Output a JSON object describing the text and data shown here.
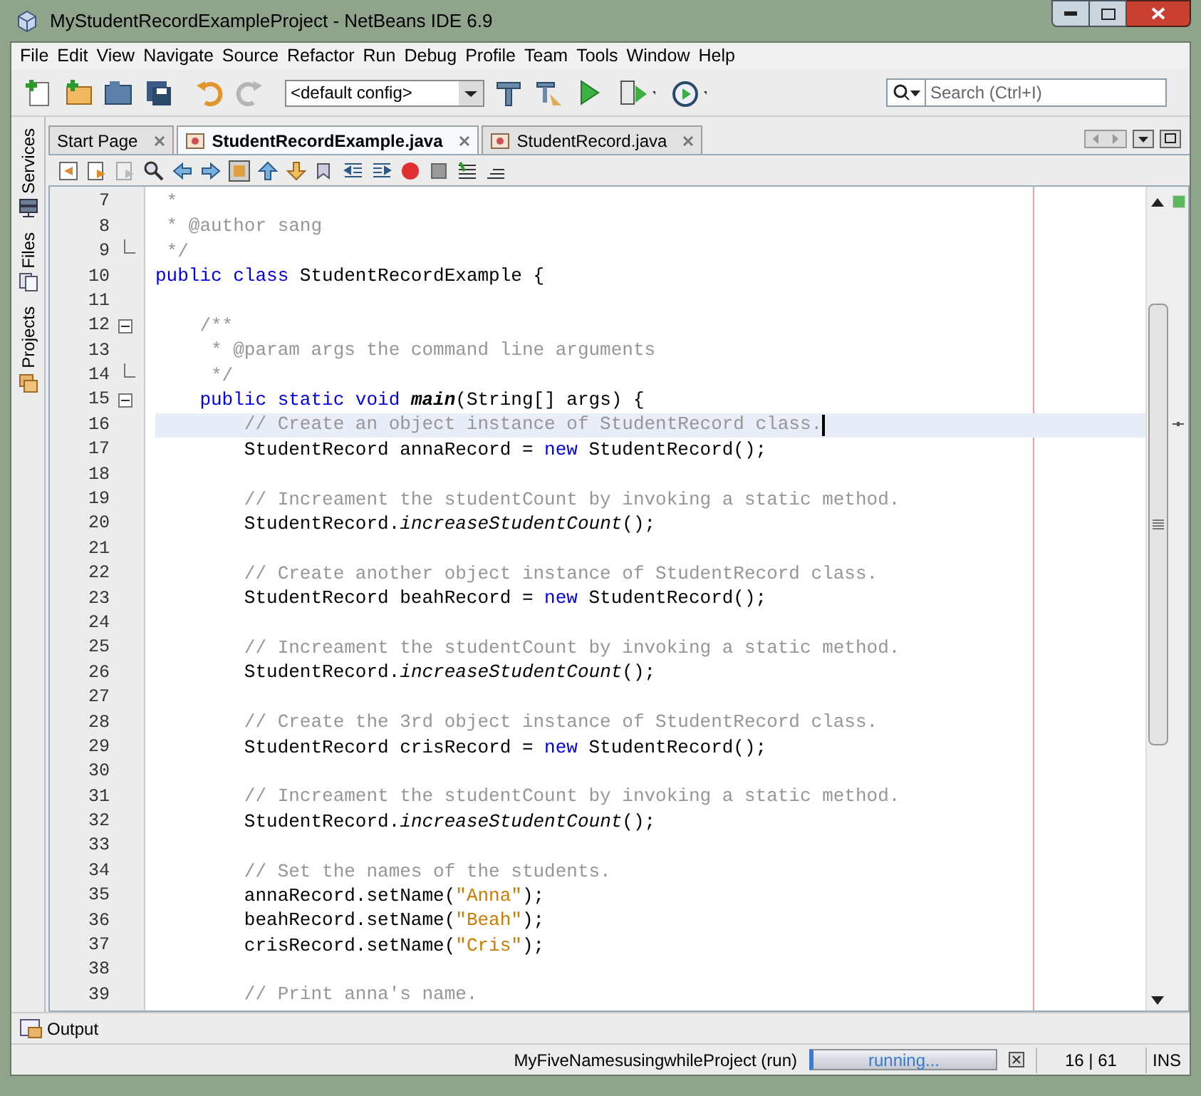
{
  "window": {
    "title": "MyStudentRecordExampleProject - NetBeans IDE 6.9"
  },
  "menu": [
    "File",
    "Edit",
    "View",
    "Navigate",
    "Source",
    "Refactor",
    "Run",
    "Debug",
    "Profile",
    "Team",
    "Tools",
    "Window",
    "Help"
  ],
  "toolbar": {
    "config": "<default config>",
    "search": {
      "placeholder": "Search (Ctrl+I)"
    }
  },
  "side_tabs": [
    {
      "label": "Services",
      "kind": "services"
    },
    {
      "label": "Files",
      "kind": "files"
    },
    {
      "label": "Projects",
      "kind": "projects"
    }
  ],
  "tabs": [
    {
      "label": "Start Page",
      "selected": false,
      "kind": "page"
    },
    {
      "label": "StudentRecordExample.java",
      "selected": true,
      "kind": "java"
    },
    {
      "label": "StudentRecord.java",
      "selected": false,
      "kind": "java"
    }
  ],
  "editor": {
    "lines": [
      {
        "number": "7",
        "kind": "code",
        "current": false,
        "tokens": [
          {
            "kind": "comment",
            "text": " *"
          }
        ]
      },
      {
        "number": "8",
        "kind": "code",
        "current": false,
        "tokens": [
          {
            "kind": "comment",
            "text": " * @author sang"
          }
        ]
      },
      {
        "number": "9",
        "kind": "fold_end",
        "current": false,
        "tokens": [
          {
            "kind": "comment",
            "text": " */"
          }
        ]
      },
      {
        "number": "10",
        "kind": "code",
        "current": false,
        "tokens": [
          {
            "kind": "keyword",
            "text": "public class "
          },
          {
            "kind": "plain",
            "text": "StudentRecordExample {"
          }
        ]
      },
      {
        "number": "11",
        "kind": "code",
        "current": false
      },
      {
        "number": "12",
        "kind": "fold_start",
        "current": false,
        "tokens": [
          {
            "kind": "comment",
            "text": "    /**"
          }
        ]
      },
      {
        "number": "13",
        "kind": "code",
        "current": false,
        "tokens": [
          {
            "kind": "comment",
            "text": "     * @param args the command line arguments"
          }
        ]
      },
      {
        "number": "14",
        "kind": "fold_end",
        "current": false,
        "tokens": [
          {
            "kind": "comment",
            "text": "     */"
          }
        ]
      },
      {
        "number": "15",
        "kind": "fold_start",
        "current": false,
        "tokens": [
          {
            "kind": "keyword",
            "text": "    public static void "
          },
          {
            "kind": "declaration",
            "text": "main"
          },
          {
            "kind": "plain",
            "text": "(String[] args) {"
          }
        ]
      },
      {
        "number": "16",
        "kind": "code",
        "current": true,
        "tokens": [
          {
            "kind": "comment",
            "text": "        // Create an object instance of StudentRecord class."
          }
        ]
      },
      {
        "number": "17",
        "kind": "code",
        "current": false,
        "tokens": [
          {
            "kind": "plain",
            "text": "        StudentRecord annaRecord = "
          },
          {
            "kind": "keyword",
            "text": "new"
          },
          {
            "kind": "plain",
            "text": " StudentRecord();"
          }
        ]
      },
      {
        "number": "18",
        "kind": "code",
        "current": false
      },
      {
        "number": "19",
        "kind": "code",
        "current": false,
        "tokens": [
          {
            "kind": "comment",
            "text": "        // Increament the studentCount by invoking a static method."
          }
        ]
      },
      {
        "number": "20",
        "kind": "code",
        "current": false,
        "tokens": [
          {
            "kind": "plain",
            "text": "        StudentRecord."
          },
          {
            "kind": "static",
            "text": "increaseStudentCount"
          },
          {
            "kind": "plain",
            "text": "();"
          }
        ]
      },
      {
        "number": "21",
        "kind": "code",
        "current": false
      },
      {
        "number": "22",
        "kind": "code",
        "current": false,
        "tokens": [
          {
            "kind": "comment",
            "text": "        // Create another object instance of StudentRecord class."
          }
        ]
      },
      {
        "number": "23",
        "kind": "code",
        "current": false,
        "tokens": [
          {
            "kind": "plain",
            "text": "        StudentRecord beahRecord = "
          },
          {
            "kind": "keyword",
            "text": "new"
          },
          {
            "kind": "plain",
            "text": " StudentRecord();"
          }
        ]
      },
      {
        "number": "24",
        "kind": "code",
        "current": false
      },
      {
        "number": "25",
        "kind": "code",
        "current": false,
        "tokens": [
          {
            "kind": "comment",
            "text": "        // Increament the studentCount by invoking a static method."
          }
        ]
      },
      {
        "number": "26",
        "kind": "code",
        "current": false,
        "tokens": [
          {
            "kind": "plain",
            "text": "        StudentRecord."
          },
          {
            "kind": "static",
            "text": "increaseStudentCount"
          },
          {
            "kind": "plain",
            "text": "();"
          }
        ]
      },
      {
        "number": "27",
        "kind": "code",
        "current": false
      },
      {
        "number": "28",
        "kind": "code",
        "current": false,
        "tokens": [
          {
            "kind": "comment",
            "text": "        // Create the 3rd object instance of StudentRecord class."
          }
        ]
      },
      {
        "number": "29",
        "kind": "code",
        "current": false,
        "tokens": [
          {
            "kind": "plain",
            "text": "        StudentRecord crisRecord = "
          },
          {
            "kind": "keyword",
            "text": "new"
          },
          {
            "kind": "plain",
            "text": " StudentRecord();"
          }
        ]
      },
      {
        "number": "30",
        "kind": "code",
        "current": false
      },
      {
        "number": "31",
        "kind": "code",
        "current": false,
        "tokens": [
          {
            "kind": "comment",
            "text": "        // Increament the studentCount by invoking a static method."
          }
        ]
      },
      {
        "number": "32",
        "kind": "code",
        "current": false,
        "tokens": [
          {
            "kind": "plain",
            "text": "        StudentRecord."
          },
          {
            "kind": "static",
            "text": "increaseStudentCount"
          },
          {
            "kind": "plain",
            "text": "();"
          }
        ]
      },
      {
        "number": "33",
        "kind": "code",
        "current": false
      },
      {
        "number": "34",
        "kind": "code",
        "current": false,
        "tokens": [
          {
            "kind": "comment",
            "text": "        // Set the names of the students."
          }
        ]
      },
      {
        "number": "35",
        "kind": "code",
        "current": false,
        "tokens": [
          {
            "kind": "plain",
            "text": "        annaRecord.setName("
          },
          {
            "kind": "string",
            "text": "\"Anna\""
          },
          {
            "kind": "plain",
            "text": ");"
          }
        ]
      },
      {
        "number": "36",
        "kind": "code",
        "current": false,
        "tokens": [
          {
            "kind": "plain",
            "text": "        beahRecord.setName("
          },
          {
            "kind": "string",
            "text": "\"Beah\""
          },
          {
            "kind": "plain",
            "text": ");"
          }
        ]
      },
      {
        "number": "37",
        "kind": "code",
        "current": false,
        "tokens": [
          {
            "kind": "plain",
            "text": "        crisRecord.setName("
          },
          {
            "kind": "string",
            "text": "\"Cris\""
          },
          {
            "kind": "plain",
            "text": ");"
          }
        ]
      },
      {
        "number": "38",
        "kind": "code",
        "current": false
      },
      {
        "number": "39",
        "kind": "code",
        "current": false,
        "tokens": [
          {
            "kind": "comment",
            "text": "        // Print anna's name."
          }
        ]
      }
    ]
  },
  "output_tab": {
    "label": "Output"
  },
  "status_bar": {
    "task": "MyFiveNamesusingwhileProject (run)",
    "progress": "running...",
    "level": 1,
    "position": "16 | 61",
    "mode": "INS"
  }
}
